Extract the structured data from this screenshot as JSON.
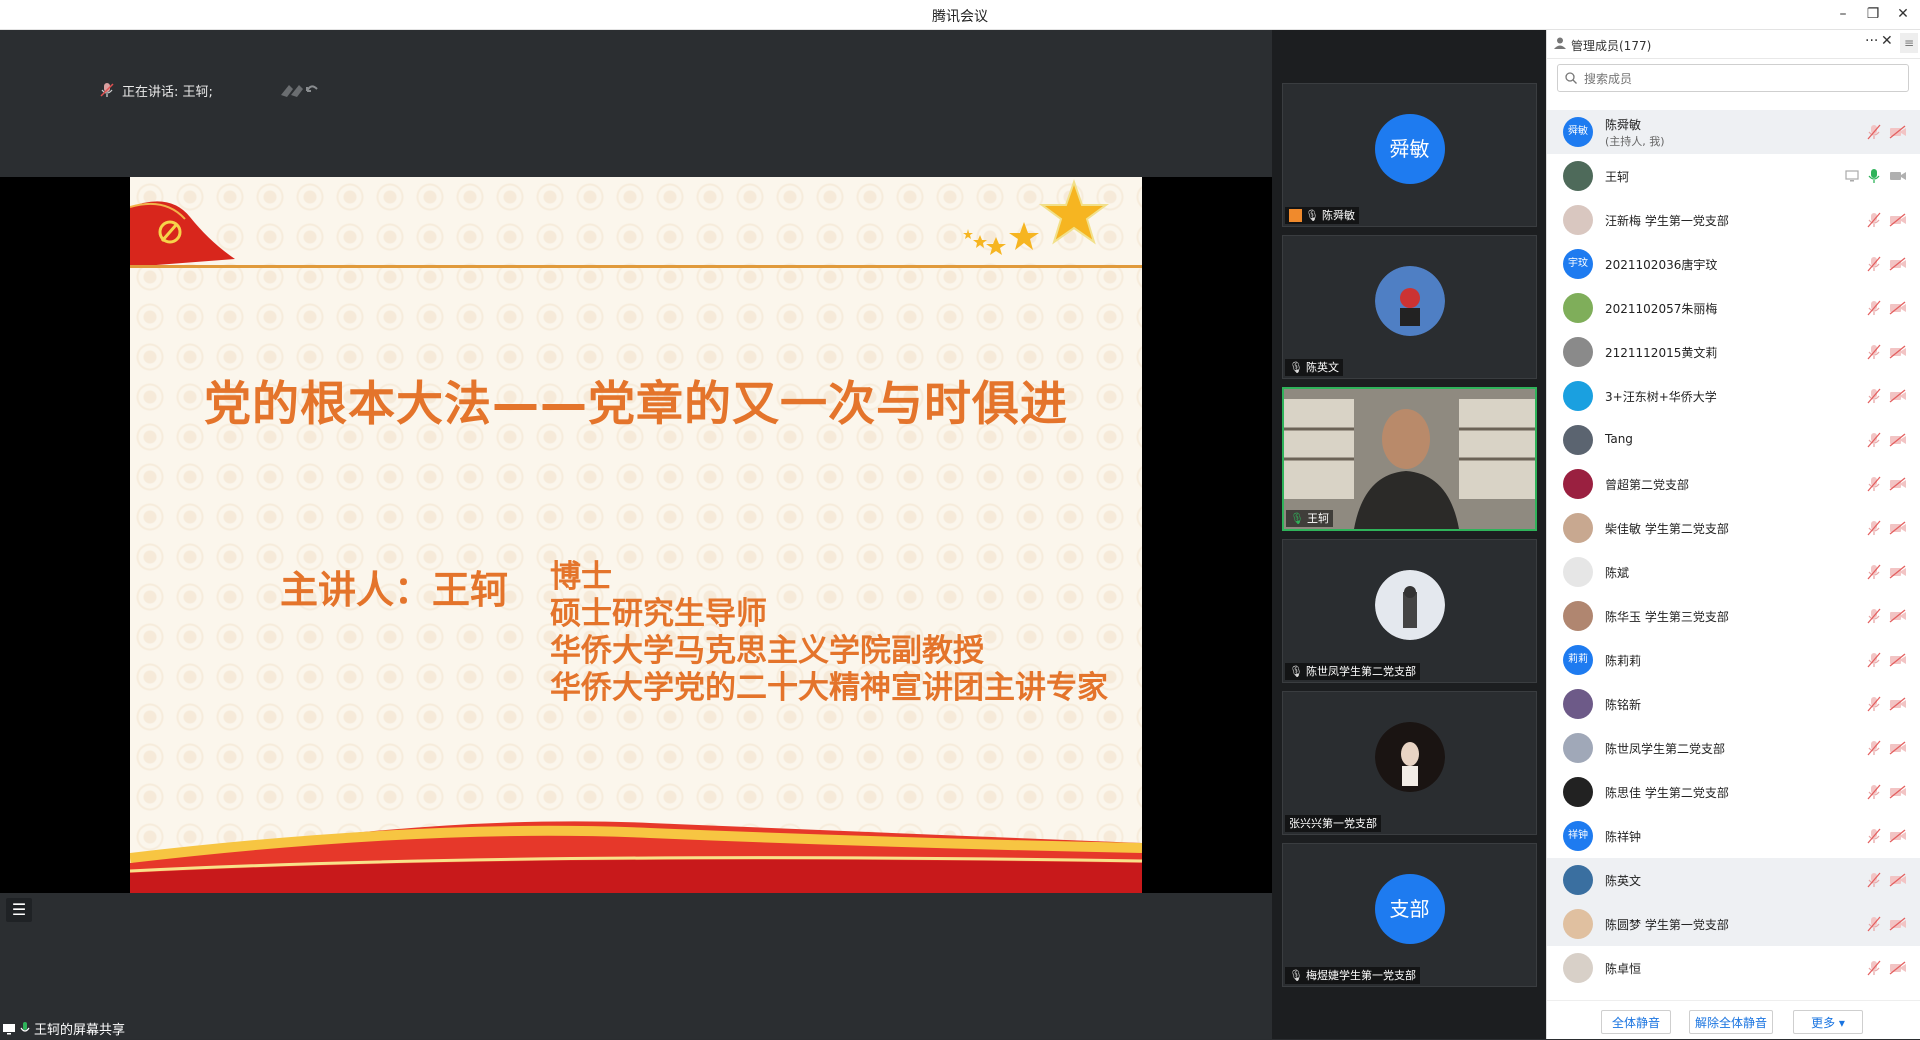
{
  "window": {
    "title": "腾讯会议",
    "minimize": "–",
    "restore": "❐",
    "close": "✕"
  },
  "stage": {
    "speaking_label": "正在讲话: 王轲;",
    "share_label": "王轲的屏幕共享"
  },
  "slide": {
    "heading": "党的根本大法——党章的又一次与时俱进",
    "speaker": "主讲人：王轲",
    "credentials": [
      "博士",
      "硕士研究生导师",
      "华侨大学马克思主义学院副教授",
      "华侨大学党的二十大精神宣讲团主讲专家"
    ]
  },
  "video_tiles": [
    {
      "name": "陈舜敏",
      "avatar_text": "舜敏",
      "kind": "circle"
    },
    {
      "name": "陈英文",
      "kind": "photo"
    },
    {
      "name": "王轲",
      "kind": "camera"
    },
    {
      "name": "陈世凤学生第二党支部",
      "kind": "photo"
    },
    {
      "name": "张兴兴第一党支部",
      "kind": "photo"
    },
    {
      "name": "梅煜婕学生第一党支部",
      "avatar_text": "支部",
      "kind": "circle"
    }
  ],
  "panel": {
    "title": "管理成员(177)",
    "more_icon": "···",
    "search_placeholder": "搜索成员",
    "members": [
      {
        "name": "陈舜敏",
        "sub": "(主持人, 我)",
        "avatar_text": "舜敏",
        "avatar_color": "#1e7bf0",
        "highlight": true
      },
      {
        "name": "王轲",
        "avatar_text": "",
        "avatar_color": "#4e6a5a",
        "speaking": true
      },
      {
        "name": "汪新梅  学生第一党支部",
        "avatar_text": "",
        "avatar_color": "#d9c7c0"
      },
      {
        "name": "2021102036唐宇玟",
        "avatar_text": "宇玟",
        "avatar_color": "#1e7bf0"
      },
      {
        "name": "2021102057朱丽梅",
        "avatar_text": "",
        "avatar_color": "#7fae5a"
      },
      {
        "name": "2121112015黄文莉",
        "avatar_text": "",
        "avatar_color": "#8a8a8a"
      },
      {
        "name": "3+汪东树+华侨大学",
        "avatar_text": "",
        "avatar_color": "#1aa0e0"
      },
      {
        "name": "Tang",
        "avatar_text": "",
        "avatar_color": "#5b6470"
      },
      {
        "name": "曾超第二党支部",
        "avatar_text": "",
        "avatar_color": "#9a2040"
      },
      {
        "name": "柴佳敏 学生第二党支部",
        "avatar_text": "",
        "avatar_color": "#c8a890"
      },
      {
        "name": "陈斌",
        "avatar_text": "",
        "avatar_color": "#e6e6e6"
      },
      {
        "name": "陈华玉  学生第三党支部",
        "avatar_text": "",
        "avatar_color": "#b08670"
      },
      {
        "name": "陈莉莉",
        "avatar_text": "莉莉",
        "avatar_color": "#1e7bf0"
      },
      {
        "name": "陈铭新",
        "avatar_text": "",
        "avatar_color": "#6d5a88"
      },
      {
        "name": "陈世凤学生第二党支部",
        "avatar_text": "",
        "avatar_color": "#a0a8b8"
      },
      {
        "name": "陈思佳 学生第二党支部",
        "avatar_text": "",
        "avatar_color": "#222222"
      },
      {
        "name": "陈祥钟",
        "avatar_text": "祥钟",
        "avatar_color": "#1e7bf0"
      },
      {
        "name": "陈英文",
        "avatar_text": "",
        "avatar_color": "#3a6fa0",
        "highlight": true
      },
      {
        "name": "陈圆梦 学生第一党支部",
        "avatar_text": "",
        "avatar_color": "#e0c0a0",
        "highlight": true
      },
      {
        "name": "陈卓恒",
        "avatar_text": "",
        "avatar_color": "#d8d0c8"
      }
    ],
    "mute_all": "全体静音",
    "unmute_all": "解除全体静音",
    "more": "更多 ▾"
  },
  "colors": {
    "accent": "#1e7bf0",
    "slide_text": "#e4742b",
    "speaking_green": "#2fb35a"
  }
}
